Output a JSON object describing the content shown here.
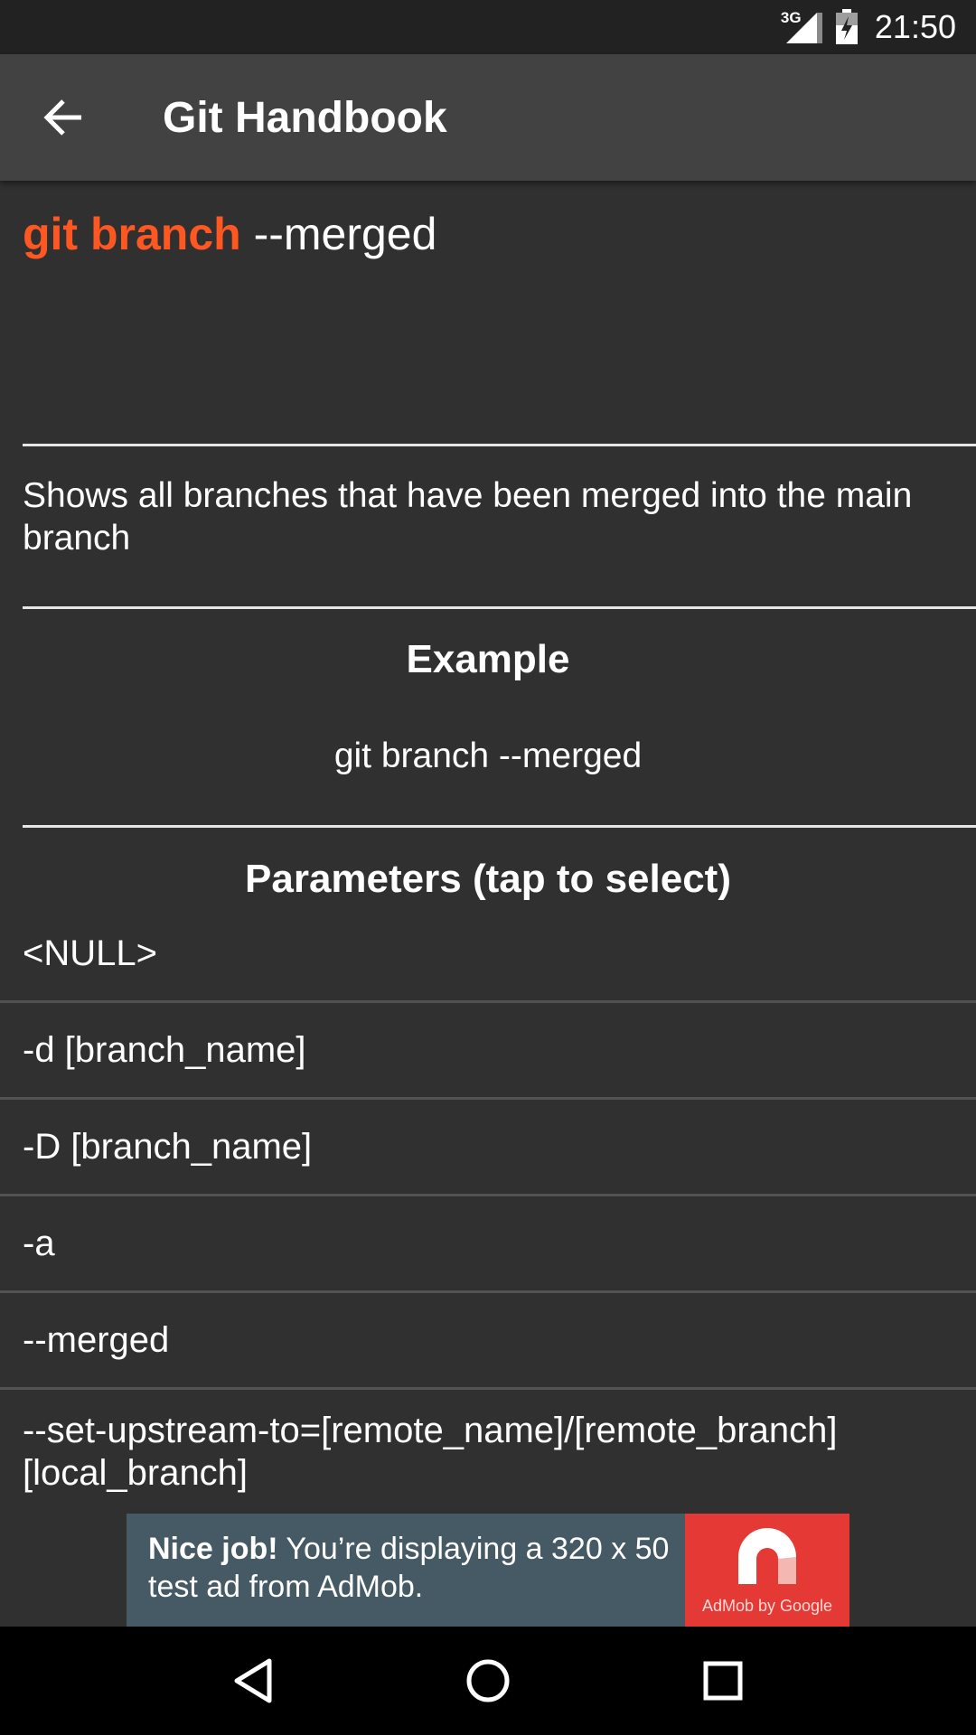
{
  "status_bar": {
    "network": "3G",
    "time": "21:50",
    "icons": [
      "signal-icon",
      "battery-icon"
    ]
  },
  "app_bar": {
    "title": "Git Handbook",
    "back_icon": "arrow-left-icon"
  },
  "command": {
    "name": "git branch",
    "argument": "--merged"
  },
  "description": "Shows all branches that have been merged into the main branch",
  "example": {
    "heading": "Example",
    "text": "git branch --merged"
  },
  "parameters": {
    "heading": "Parameters (tap to select)",
    "items": [
      "<NULL>",
      "-d [branch_name]",
      "-D [branch_name]",
      "-a",
      "--merged",
      "--set-upstream-to=[remote_name]/[remote_branch] [local_branch]"
    ]
  },
  "ad": {
    "strong": "Nice job!",
    "text": " You’re displaying a 320 x 50 test ad from AdMob.",
    "logo_caption": "AdMob by Google",
    "colors": {
      "banner": "#455a64",
      "logo": "#e53935"
    }
  },
  "colors": {
    "accent": "#ff5722",
    "background": "#303030",
    "app_bar": "#424242"
  },
  "nav_bar": {
    "icons": [
      "back-triangle-icon",
      "home-circle-icon",
      "recents-square-icon"
    ]
  }
}
